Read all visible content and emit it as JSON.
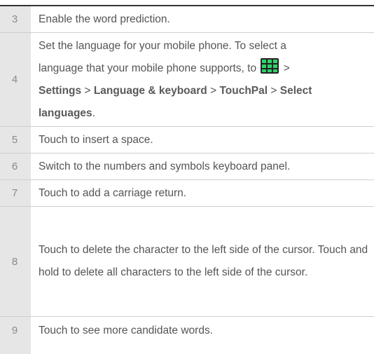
{
  "rows": [
    {
      "num": "3",
      "text": "Enable the word prediction."
    },
    {
      "num": "4",
      "line1": "Set the language for your mobile phone. To select a",
      "line2_pre": "language that your mobile phone supports, to",
      "icon": "app-grid-icon",
      "line2_post": ">",
      "path": [
        "Settings",
        "Language & keyboard",
        "TouchPal",
        "Select languages"
      ],
      "sep": ">",
      "end": "."
    },
    {
      "num": "5",
      "text": "Touch to insert a space."
    },
    {
      "num": "6",
      "text": "Switch to the numbers and symbols keyboard panel."
    },
    {
      "num": "7",
      "text": "Touch to add a carriage return."
    },
    {
      "num": "8",
      "text": "Touch to delete the character to the left side of the cursor. Touch and hold to delete all characters to the left side of the cursor."
    },
    {
      "num": "9",
      "text": "Touch to see more candidate words."
    }
  ],
  "colors": {
    "index_bg": "#e6e6e6",
    "icon_bg": "#222222",
    "icon_cells": "#2fd36a",
    "text": "#555555"
  }
}
